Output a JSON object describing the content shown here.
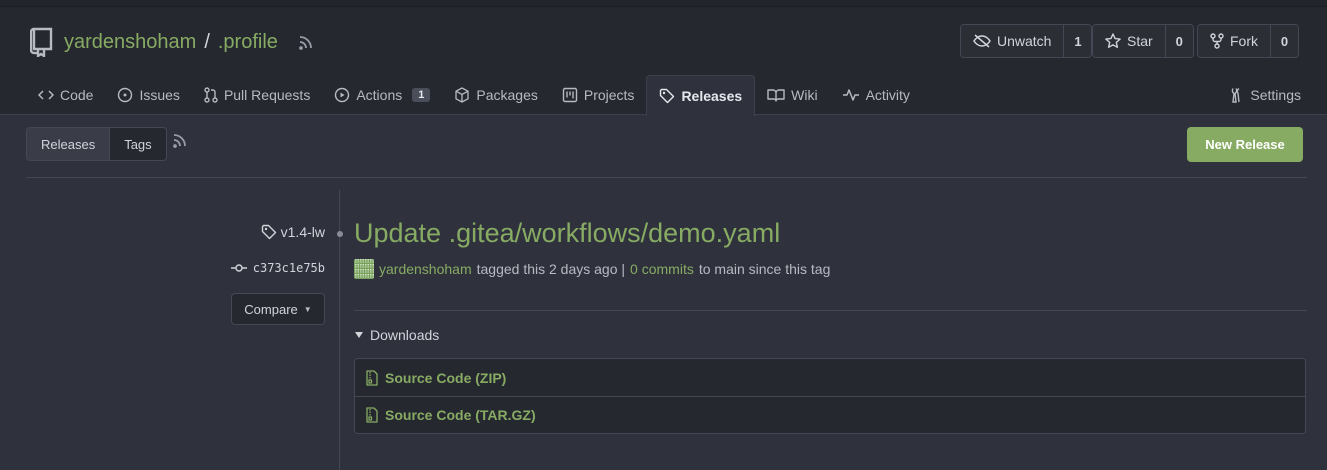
{
  "repo": {
    "owner": "yardenshoham",
    "separator": "/",
    "name": ".profile"
  },
  "repo_actions": {
    "watch": {
      "label": "Unwatch",
      "count": "1"
    },
    "star": {
      "label": "Star",
      "count": "0"
    },
    "fork": {
      "label": "Fork",
      "count": "0"
    }
  },
  "tabs": [
    {
      "label": "Code",
      "icon": "code-icon"
    },
    {
      "label": "Issues",
      "icon": "issue-icon"
    },
    {
      "label": "Pull Requests",
      "icon": "pull-request-icon"
    },
    {
      "label": "Actions",
      "icon": "play-icon",
      "badge": "1"
    },
    {
      "label": "Packages",
      "icon": "package-icon"
    },
    {
      "label": "Projects",
      "icon": "project-icon"
    },
    {
      "label": "Releases",
      "icon": "tag-icon",
      "active": true
    },
    {
      "label": "Wiki",
      "icon": "book-icon"
    },
    {
      "label": "Activity",
      "icon": "pulse-icon"
    }
  ],
  "settings_label": "Settings",
  "segment": {
    "releases_label": "Releases",
    "tags_label": "Tags"
  },
  "new_release_label": "New Release",
  "release": {
    "tag": "v1.4-lw",
    "commit": "c373c1e75b",
    "compare_label": "Compare",
    "title": "Update .gitea/workflows/demo.yaml",
    "author": "yardenshoham",
    "tagged_text": "tagged this 2 days ago |",
    "commits_link": "0 commits",
    "since_text": "to main since this tag",
    "downloads_label": "Downloads",
    "downloads": [
      {
        "label": "Source Code (ZIP)"
      },
      {
        "label": "Source Code (TAR.GZ)"
      }
    ]
  },
  "colors": {
    "accent": "#87ab63",
    "background": "#2f323d",
    "header": "#262830",
    "border": "#454854"
  }
}
